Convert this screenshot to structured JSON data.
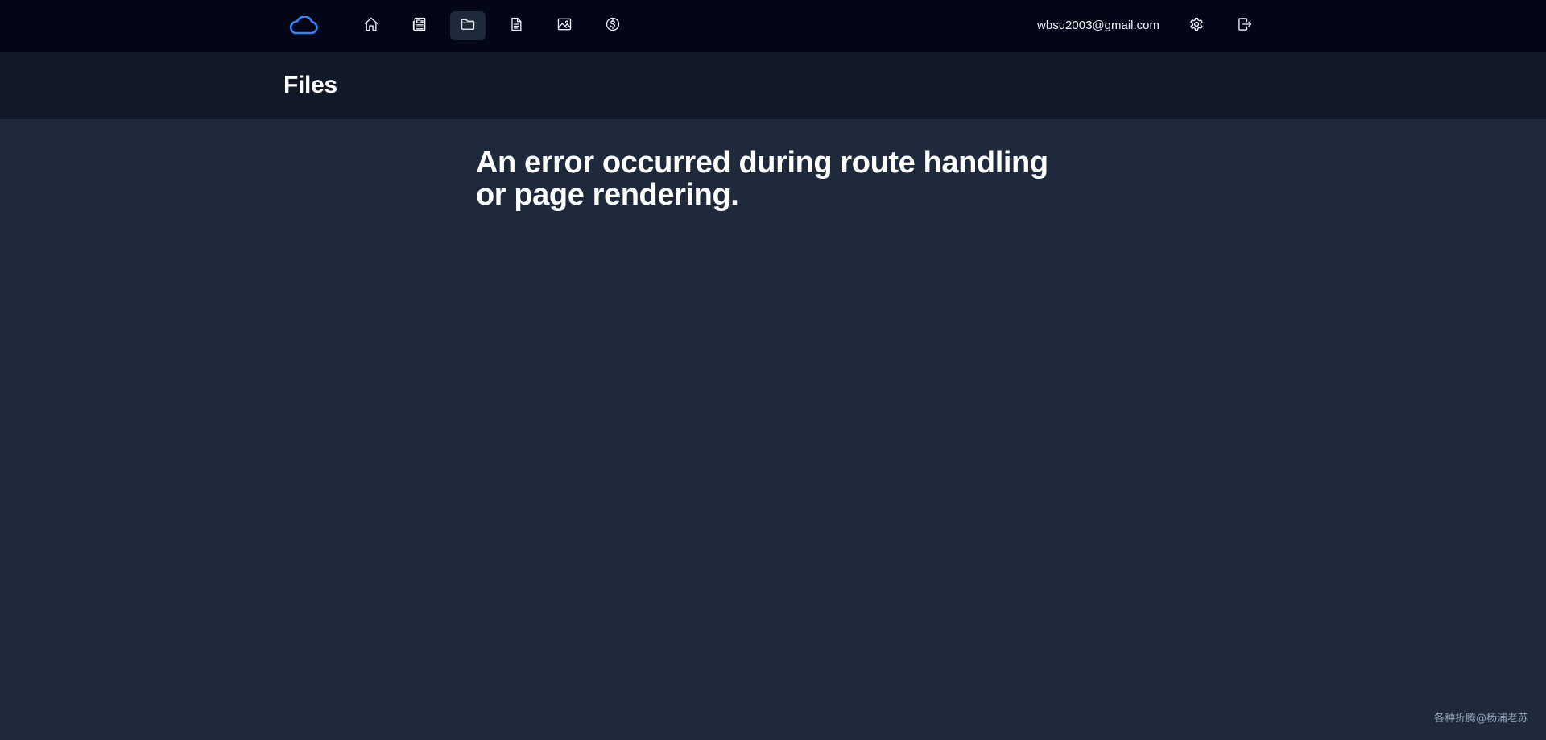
{
  "topbar": {
    "nav_icons": [
      "home-icon",
      "newspaper-icon",
      "folder-icon",
      "document-icon",
      "image-icon",
      "dollar-icon"
    ],
    "active_nav": "folder-icon",
    "user_email": "wbsu2003@gmail.com",
    "right_icons": [
      "gear-icon",
      "logout-icon"
    ]
  },
  "header": {
    "title": "Files"
  },
  "main": {
    "error_message": "An error occurred during route handling or page rendering."
  },
  "watermark": {
    "text": "各种折腾@杨浦老苏"
  },
  "colors": {
    "topbar_bg": "#030617",
    "header_bg": "#111827",
    "page_bg": "#1e293b",
    "logo_accent": "#3b82f6",
    "text": "#ffffff"
  }
}
